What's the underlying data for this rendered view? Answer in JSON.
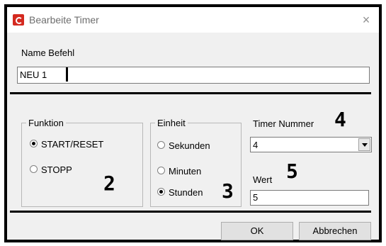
{
  "window": {
    "title": "Bearbeite Timer",
    "close_symbol": "×",
    "icon": "app-logo-icon"
  },
  "name_section": {
    "label": "Name Befehl",
    "value": "NEU 1"
  },
  "funktion": {
    "legend": "Funktion",
    "options": [
      {
        "label": "START/RESET",
        "checked": true
      },
      {
        "label": "STOPP",
        "checked": false
      }
    ],
    "annotation": "2"
  },
  "einheit": {
    "legend": "Einheit",
    "options": [
      {
        "label": "Sekunden",
        "checked": false
      },
      {
        "label": "Minuten",
        "checked": false
      },
      {
        "label": "Stunden",
        "checked": true
      }
    ],
    "annotation": "3"
  },
  "timer_nummer": {
    "label": "Timer Nummer",
    "selected": "4",
    "annotation": "4"
  },
  "wert": {
    "label": "Wert",
    "value": "5",
    "annotation": "5"
  },
  "buttons": {
    "ok": "OK",
    "cancel": "Abbrechen"
  },
  "colors": {
    "dialog_bg": "#f0f0f0",
    "icon_red": "#d42a20",
    "outline": "#000000"
  }
}
